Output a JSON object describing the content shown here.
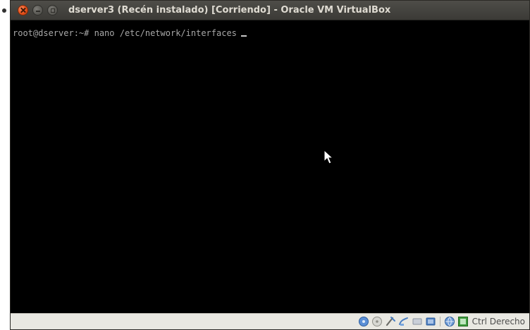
{
  "window": {
    "title": "dserver3 (Recén instalado) [Corriendo] - Oracle VM VirtualBox",
    "controls": {
      "close_icon": "close-icon",
      "minimize_icon": "minimize-icon",
      "maximize_icon": "maximize-icon"
    }
  },
  "terminal": {
    "prompt": "root@dserver:~#",
    "command": "nano /etc/network/interfaces",
    "background": "#000000",
    "text_color": "#a8a8a8"
  },
  "statusbar": {
    "icons": [
      "hard-disk-icon",
      "optical-drive-icon",
      "usb-icon",
      "shared-folders-icon",
      "display-icon",
      "video-capture-icon",
      "network-icon",
      "virtualization-icon"
    ],
    "host_key": "Ctrl Derecho"
  },
  "colors": {
    "titlebar": "#3c3b37",
    "title_text": "#dfdbd2",
    "close_button": "#e6511b",
    "statusbar": "#e9e8e2"
  }
}
